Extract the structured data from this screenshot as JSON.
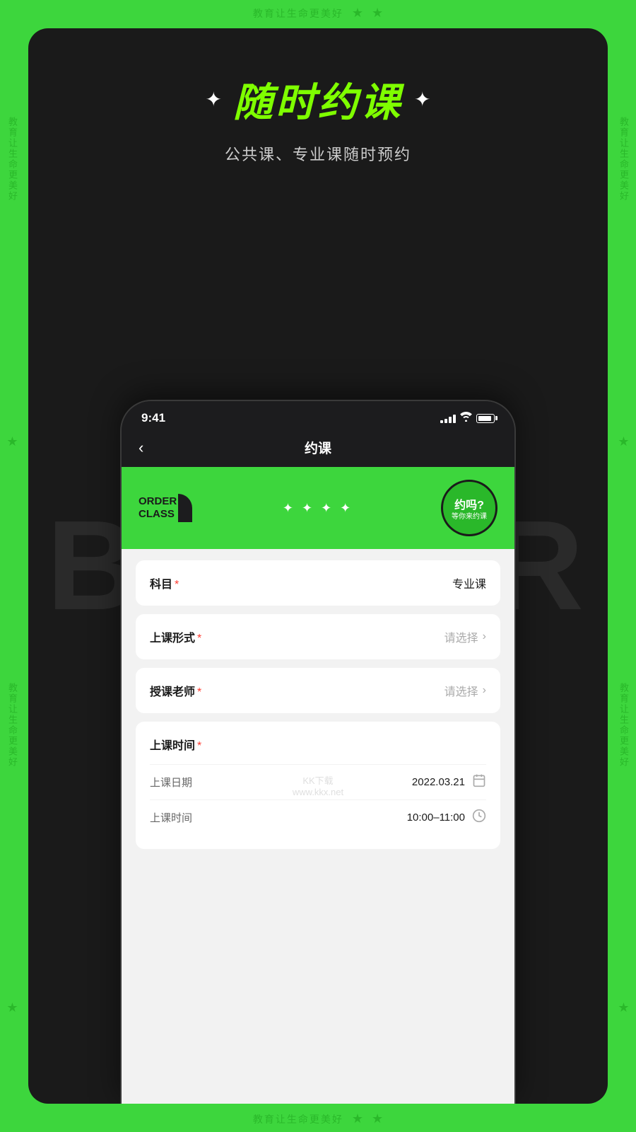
{
  "bg": {
    "top_text": "教育让生命更美好",
    "top_star1": "★",
    "top_star2": "★",
    "bottom_text": "教育让生命更美好",
    "bottom_star1": "★",
    "bottom_star2": "★",
    "left_text1": "教育让生命更美好",
    "left_text2": "教育让生命更美好",
    "left_star1": "★",
    "left_star2": "★",
    "right_text1": "教育让生命更美好",
    "right_text2": "教育让生命更美好",
    "right_star1": "★",
    "right_star2": "★"
  },
  "hero": {
    "sparkle_left": "✦",
    "title": "随时约课",
    "sparkle_right": "✦",
    "subtitle": "公共课、专业课随时预约",
    "better_text": "BETTER"
  },
  "status_bar": {
    "time": "9:41"
  },
  "nav": {
    "back_icon": "‹",
    "title": "约课"
  },
  "banner": {
    "order_class_line1": "ORDER",
    "order_class_line2": "CLASS",
    "star1": "✦",
    "star2": "✦",
    "star3": "✦",
    "star4": "✦",
    "badge_main": "约吗?",
    "badge_sub": "等你来约课"
  },
  "form": {
    "subject_label": "科目",
    "subject_required": "*",
    "subject_value": "专业课",
    "class_format_label": "上课形式",
    "class_format_required": "*",
    "class_format_placeholder": "请选择",
    "teacher_label": "授课老师",
    "teacher_required": "*",
    "teacher_placeholder": "请选择",
    "time_section_label": "上课时间",
    "time_section_required": "*",
    "date_label": "上课日期",
    "date_value": "2022.03.21",
    "time_label": "上课时间",
    "time_value": "10:00–11:00"
  },
  "watermark": {
    "line1": "KK下载",
    "line2": "www.kkx.net"
  }
}
